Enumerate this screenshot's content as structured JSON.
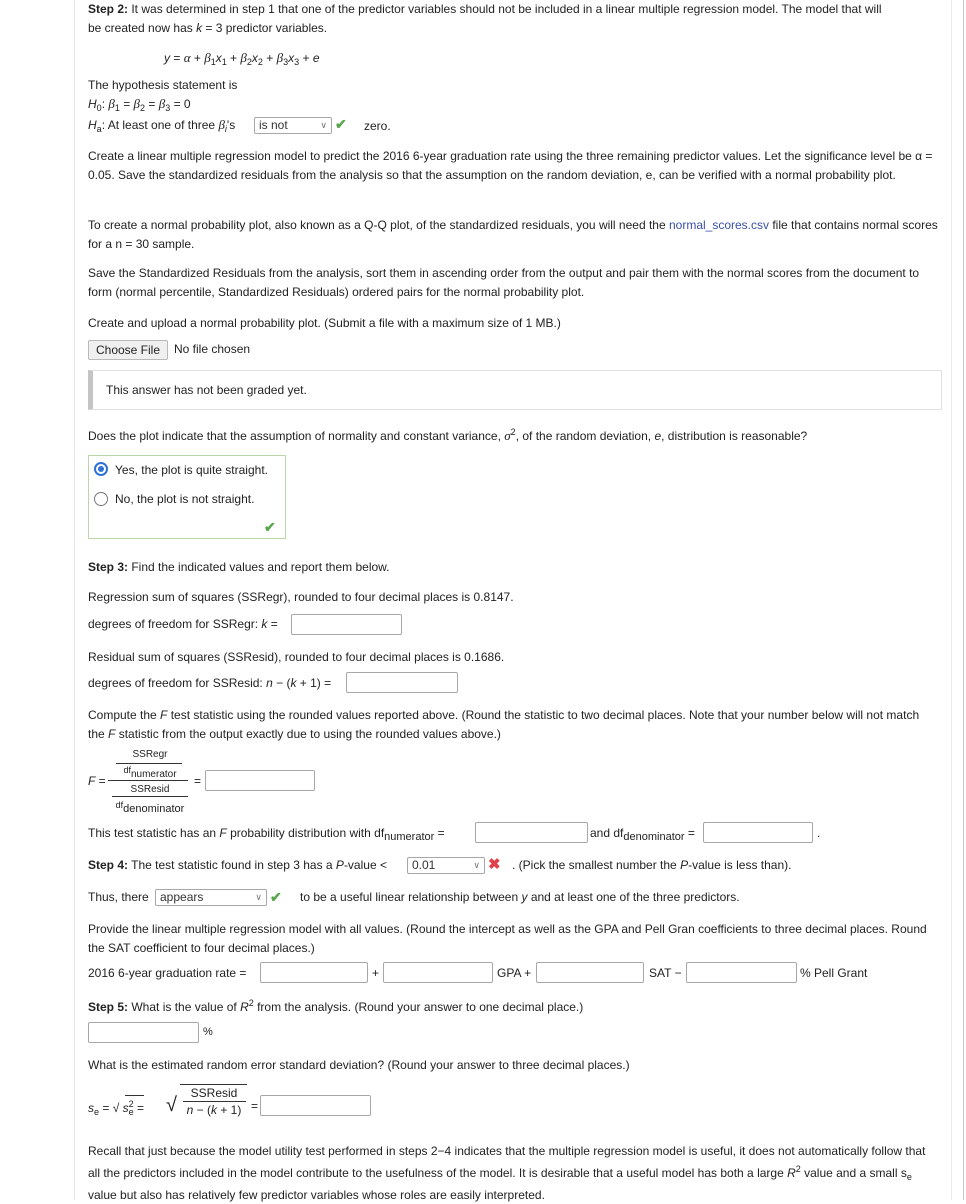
{
  "step2": {
    "label": "Step 2:",
    "text_line1": " It was determined in step 1 that one of the predictor variables should not be included in a linear multiple regression model. The model that will",
    "text_line2_pre": "be created now has ",
    "text_line2_k": "k",
    "text_line2_post": " = 3 predictor variables.",
    "model_equation": "y = α + β1x1 + β2x2 + β3x3 + e",
    "hypothesis_intro": "The hypothesis statement is",
    "h0_label": "H",
    "h0_sub": "0",
    "h0_text": ": β1 = β2 = β3 = 0",
    "ha_label": "H",
    "ha_sub": "a",
    "ha_text_pre": ": At least one of three β",
    "ha_text_sub": "i",
    "ha_text_post": "'s",
    "ha_select_value": "is not",
    "ha_suffix": "zero.",
    "ha_status": "correct",
    "para1": "Create a linear multiple regression model to predict the 2016 6-year graduation rate using the three remaining predictor values. Let the significance level be α = 0.05. Save the standardized residuals from the analysis so that the assumption on the random deviation, e, can be verified with a normal probability plot.",
    "para2_pre": "To create a normal probability plot, also known as a Q-Q plot, of the standardized residuals, you will need the ",
    "para2_link": "normal_scores.csv",
    "para2_post": " file that contains normal scores for a n = 30 sample.",
    "para3": "Save the Standardized Residuals from the analysis, sort them in ascending order from the output and pair them with the normal scores from the document to form (normal percentile, Standardized Residuals) ordered pairs for the normal probability plot.",
    "upload_prompt": "Create and upload a normal probability plot. (Submit a file with a maximum size of 1 MB.)",
    "choose_file_label": "Choose File",
    "no_file_label": "No file chosen",
    "graded_message": "This answer has not been graded yet.",
    "question": "Does the plot indicate that the assumption of normality and constant variance, σ², of the random deviation, e, distribution is reasonable?",
    "options": [
      {
        "label": "Yes, the plot is quite straight.",
        "selected": true
      },
      {
        "label": "No, the plot is not straight.",
        "selected": false
      }
    ],
    "options_status": "correct"
  },
  "step3": {
    "label": "Step 3:",
    "intro": " Find the indicated values and report them below.",
    "ssregr_text": "Regression sum of squares (SSRegr), rounded to four decimal places is 0.8147.",
    "df_ssregr_label": "degrees of freedom for SSRegr: k =",
    "df_ssregr_value": "",
    "ssresid_text": "Residual sum of squares (SSResid), rounded to four decimal places is 0.1686.",
    "df_ssresid_label": "degrees of freedom for SSResid: n − (k + 1) =",
    "df_ssresid_value": "",
    "compute_text": "Compute the F test statistic using the rounded values reported above. (Round the statistic to two decimal places. Note that your number below will not match the F statistic from the output exactly due to using the rounded values above.)",
    "formula": {
      "lhs": "F =",
      "ssregr": "SSRegr",
      "df": "df",
      "numerator": "numerator",
      "ssresid": "SSResid",
      "denominator": "denominator",
      "equals": "="
    },
    "f_value": "",
    "dist_text": "This test statistic has an F probability distribution with df",
    "dist_sub_num": "numerator",
    "dist_and": "and df",
    "dist_sub_den": "denominator",
    "df_num_value": "",
    "df_den_value": ""
  },
  "step4": {
    "label": "Step 4:",
    "text_pre": " The test statistic found in step 3 has a P-value <",
    "pvalue_select": "0.01",
    "pvalue_status": "incorrect",
    "text_post": ". (Pick the smallest number the P-value is less than).",
    "thus_pre": "Thus, there",
    "thus_select": "appears",
    "thus_status": "correct",
    "thus_post": "to be a useful linear relationship between y and at least one of the three predictors.",
    "model_text": "Provide the linear multiple regression model with all values. (Round the intercept as well as the GPA and Pell Gran coefficients to three decimal places. Round the SAT coefficient to four decimal places.)",
    "model_lhs": "2016 6-year graduation rate =",
    "plus": "+",
    "gpa": "GPA +",
    "sat": "SAT −",
    "pell": "% Pell Grant",
    "coef_intercept": "",
    "coef_gpa": "",
    "coef_sat": "",
    "coef_pell": ""
  },
  "step5": {
    "label": "Step 5:",
    "text": " What is the value of R² from the analysis. (Round your answer to one decimal place.)",
    "r2_value": "",
    "percent": "%",
    "se_question": "What is the estimated random error standard deviation? (Round your answer to three decimal places.)",
    "se_formula_num": "SSResid",
    "se_formula_den": "n − (k + 1)",
    "se_value": "",
    "recall": "Recall that just because the model utility test performed in steps 2−4 indicates that the multiple regression model is useful, it does not automatically follow that all the predictors included in the model contribute to the usefulness of the model. It is desirable that a useful model has both a large R² value and a small se value but also has relatively few predictor variables whose roles are easily interpreted."
  }
}
